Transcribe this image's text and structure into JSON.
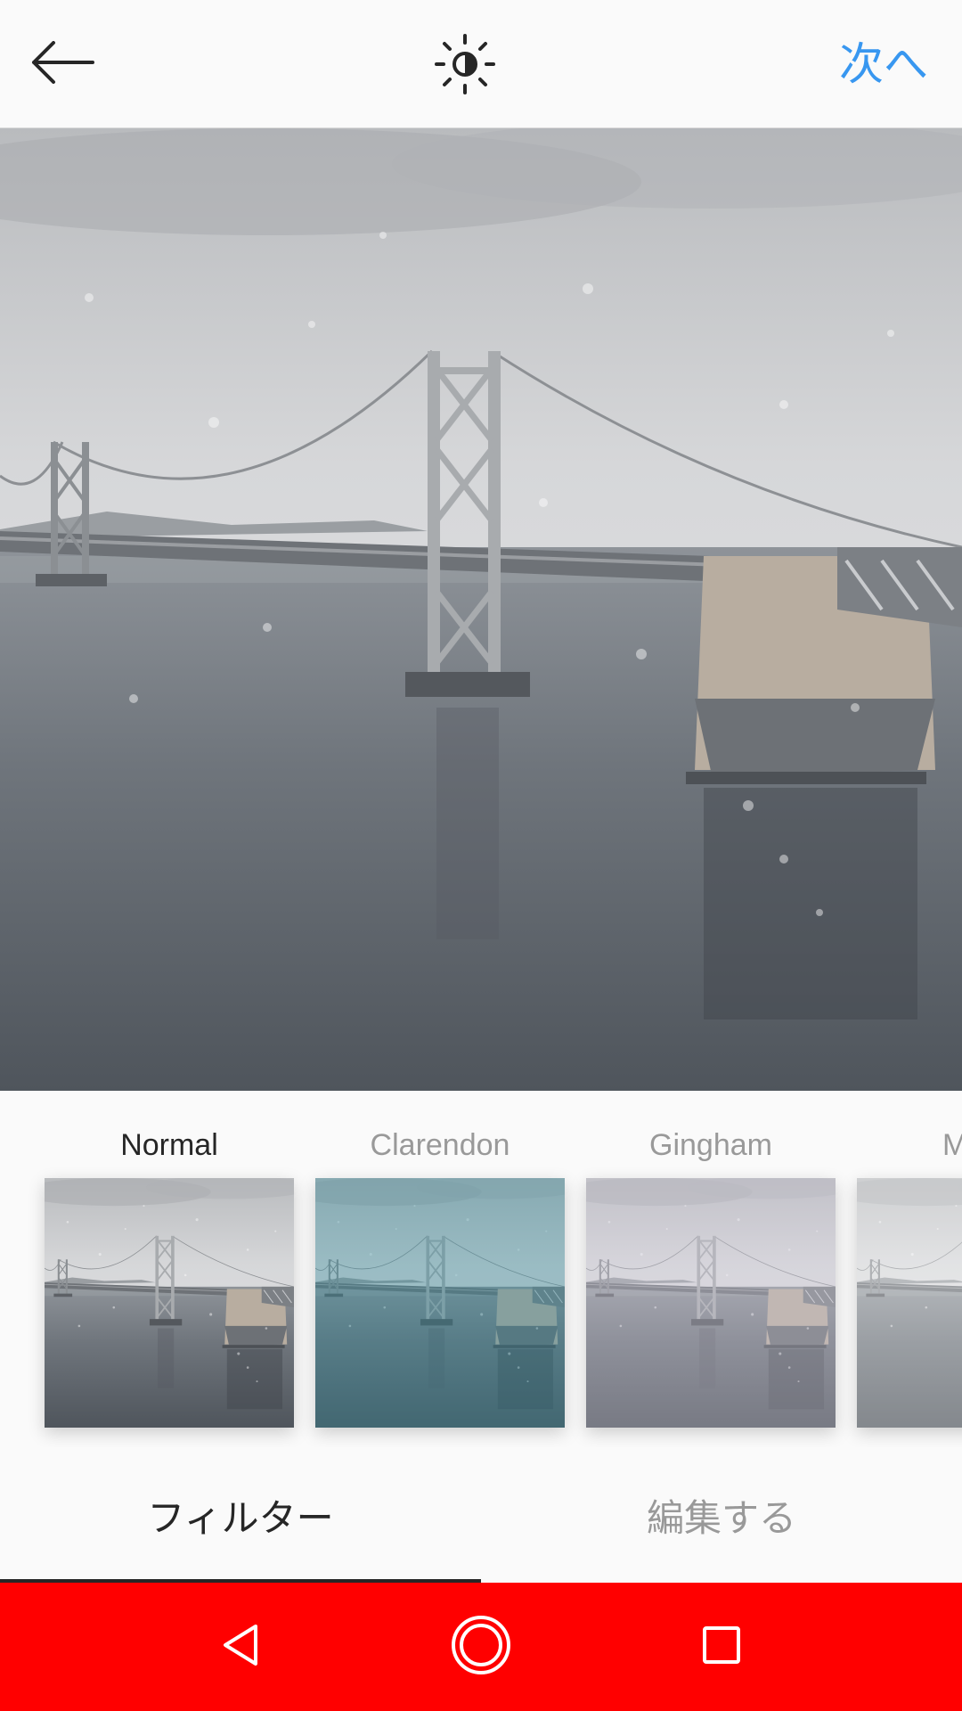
{
  "header": {
    "back_icon": "arrow-left-icon",
    "lux_icon": "sun-half-icon",
    "next_label": "次へ",
    "accent_color": "#3897f0"
  },
  "filters": [
    {
      "label": "Normal",
      "selected": true
    },
    {
      "label": "Clarendon",
      "selected": false
    },
    {
      "label": "Gingham",
      "selected": false
    },
    {
      "label": "M",
      "selected": false
    }
  ],
  "tabs": [
    {
      "label": "フィルター",
      "active": true
    },
    {
      "label": "編集する",
      "active": false
    }
  ],
  "system_nav": {
    "background": "#ff0000",
    "back_icon": "triangle-back-icon",
    "home_icon": "circle-home-icon",
    "recents_icon": "square-recents-icon"
  }
}
